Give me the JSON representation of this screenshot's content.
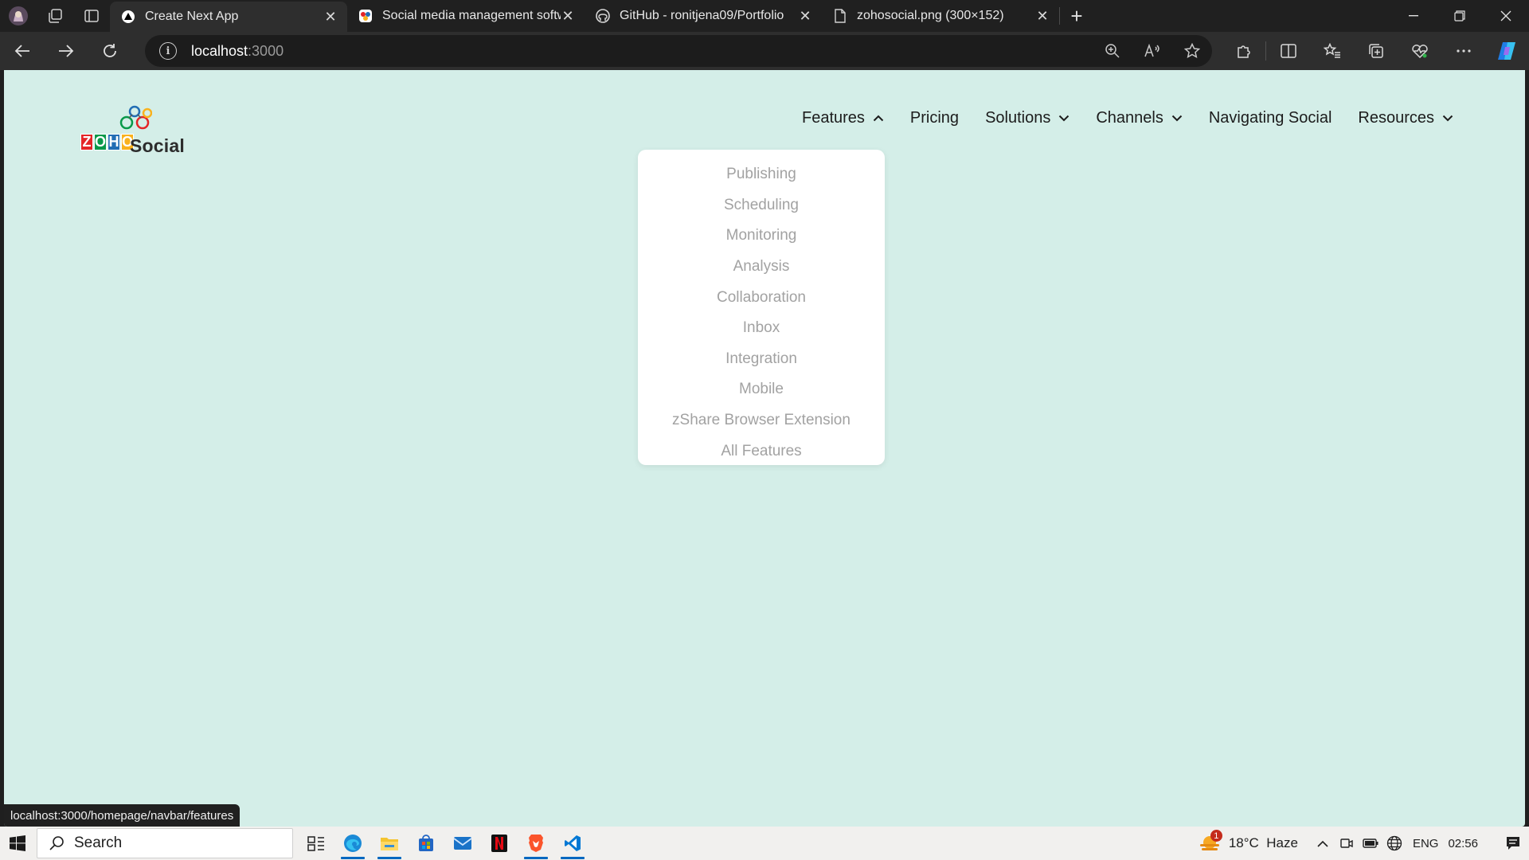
{
  "browser": {
    "tabs": [
      {
        "title": "Create Next App",
        "active": true,
        "favicon": "nextjs-icon"
      },
      {
        "title": "Social media management softw",
        "active": false,
        "favicon": "zoho-social-icon"
      },
      {
        "title": "GitHub - ronitjena09/Portfolio",
        "active": false,
        "favicon": "github-icon"
      },
      {
        "title": "zohosocial.png (300×152)",
        "active": false,
        "favicon": "file-icon"
      }
    ],
    "address": {
      "host": "localhost",
      "port": ":3000"
    }
  },
  "page": {
    "logo": {
      "brand_letters": [
        "Z",
        "O",
        "H",
        "O"
      ],
      "brand_colors": [
        "#e42527",
        "#089949",
        "#226db4",
        "#f9b21d"
      ],
      "word": "Social"
    },
    "nav": [
      {
        "label": "Features",
        "has_chevron": true,
        "expanded": true
      },
      {
        "label": "Pricing",
        "has_chevron": false
      },
      {
        "label": "Solutions",
        "has_chevron": true
      },
      {
        "label": "Channels",
        "has_chevron": true
      },
      {
        "label": "Navigating Social",
        "has_chevron": false
      },
      {
        "label": "Resources",
        "has_chevron": true
      }
    ],
    "features_menu": [
      "Publishing",
      "Scheduling",
      "Monitoring",
      "Analysis",
      "Collaboration",
      "Inbox",
      "Integration",
      "Mobile",
      "zShare Browser Extension",
      "All Features"
    ],
    "status_url": "localhost:3000/homepage/navbar/features",
    "background_color": "#d4eee8"
  },
  "taskbar": {
    "search_label": "Search",
    "apps": [
      "task-view-icon",
      "edge-icon",
      "file-explorer-icon",
      "store-icon",
      "mail-icon",
      "netflix-icon",
      "brave-icon",
      "vscode-icon"
    ],
    "weather": {
      "temp": "18°C",
      "condition": "Haze",
      "badge": "1"
    },
    "language": "ENG",
    "time": "02:56"
  }
}
